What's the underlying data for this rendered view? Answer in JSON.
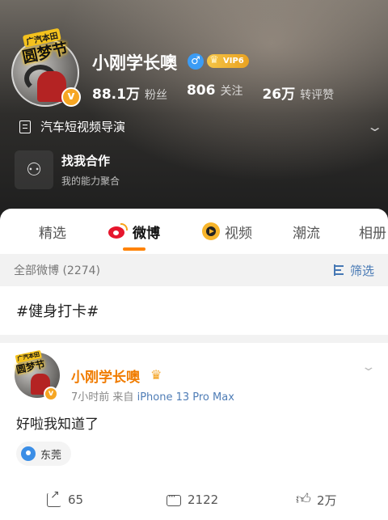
{
  "profile": {
    "name": "小刚学长噢",
    "gender_symbol": "♂",
    "vip_label": "VIP6",
    "avatar_stamp": {
      "top": "广汽本田",
      "main": "圆梦节"
    },
    "verified_symbol": "v",
    "stats": [
      {
        "num": "88.1万",
        "label": "粉丝"
      },
      {
        "num": "806",
        "label": "关注"
      },
      {
        "num": "26万",
        "label": "转评赞"
      }
    ],
    "bio": "汽车短视频导演",
    "cooperation": {
      "title": "找我合作",
      "subtitle": "我的能力聚合"
    }
  },
  "tabs": [
    {
      "label": "精选",
      "active": false
    },
    {
      "label": "微博",
      "active": true
    },
    {
      "label": "视频",
      "active": false
    },
    {
      "label": "潮流",
      "active": false
    },
    {
      "label": "相册",
      "active": false
    }
  ],
  "filter_bar": {
    "count_label": "全部微博 (2274)",
    "filter_label": "筛选"
  },
  "topic": "#健身打卡#",
  "post": {
    "author": "小刚学长噢",
    "time": "7小时前",
    "source_prefix": "来自",
    "device": "iPhone 13 Pro Max",
    "text": "好啦我知道了",
    "location": "东莞",
    "actions": {
      "shares": "65",
      "comments": "2122",
      "likes": "2万"
    }
  },
  "colors": {
    "accent": "#ff8200",
    "link": "#4678b4",
    "author": "#f07c00",
    "vip": "#f5c546"
  }
}
